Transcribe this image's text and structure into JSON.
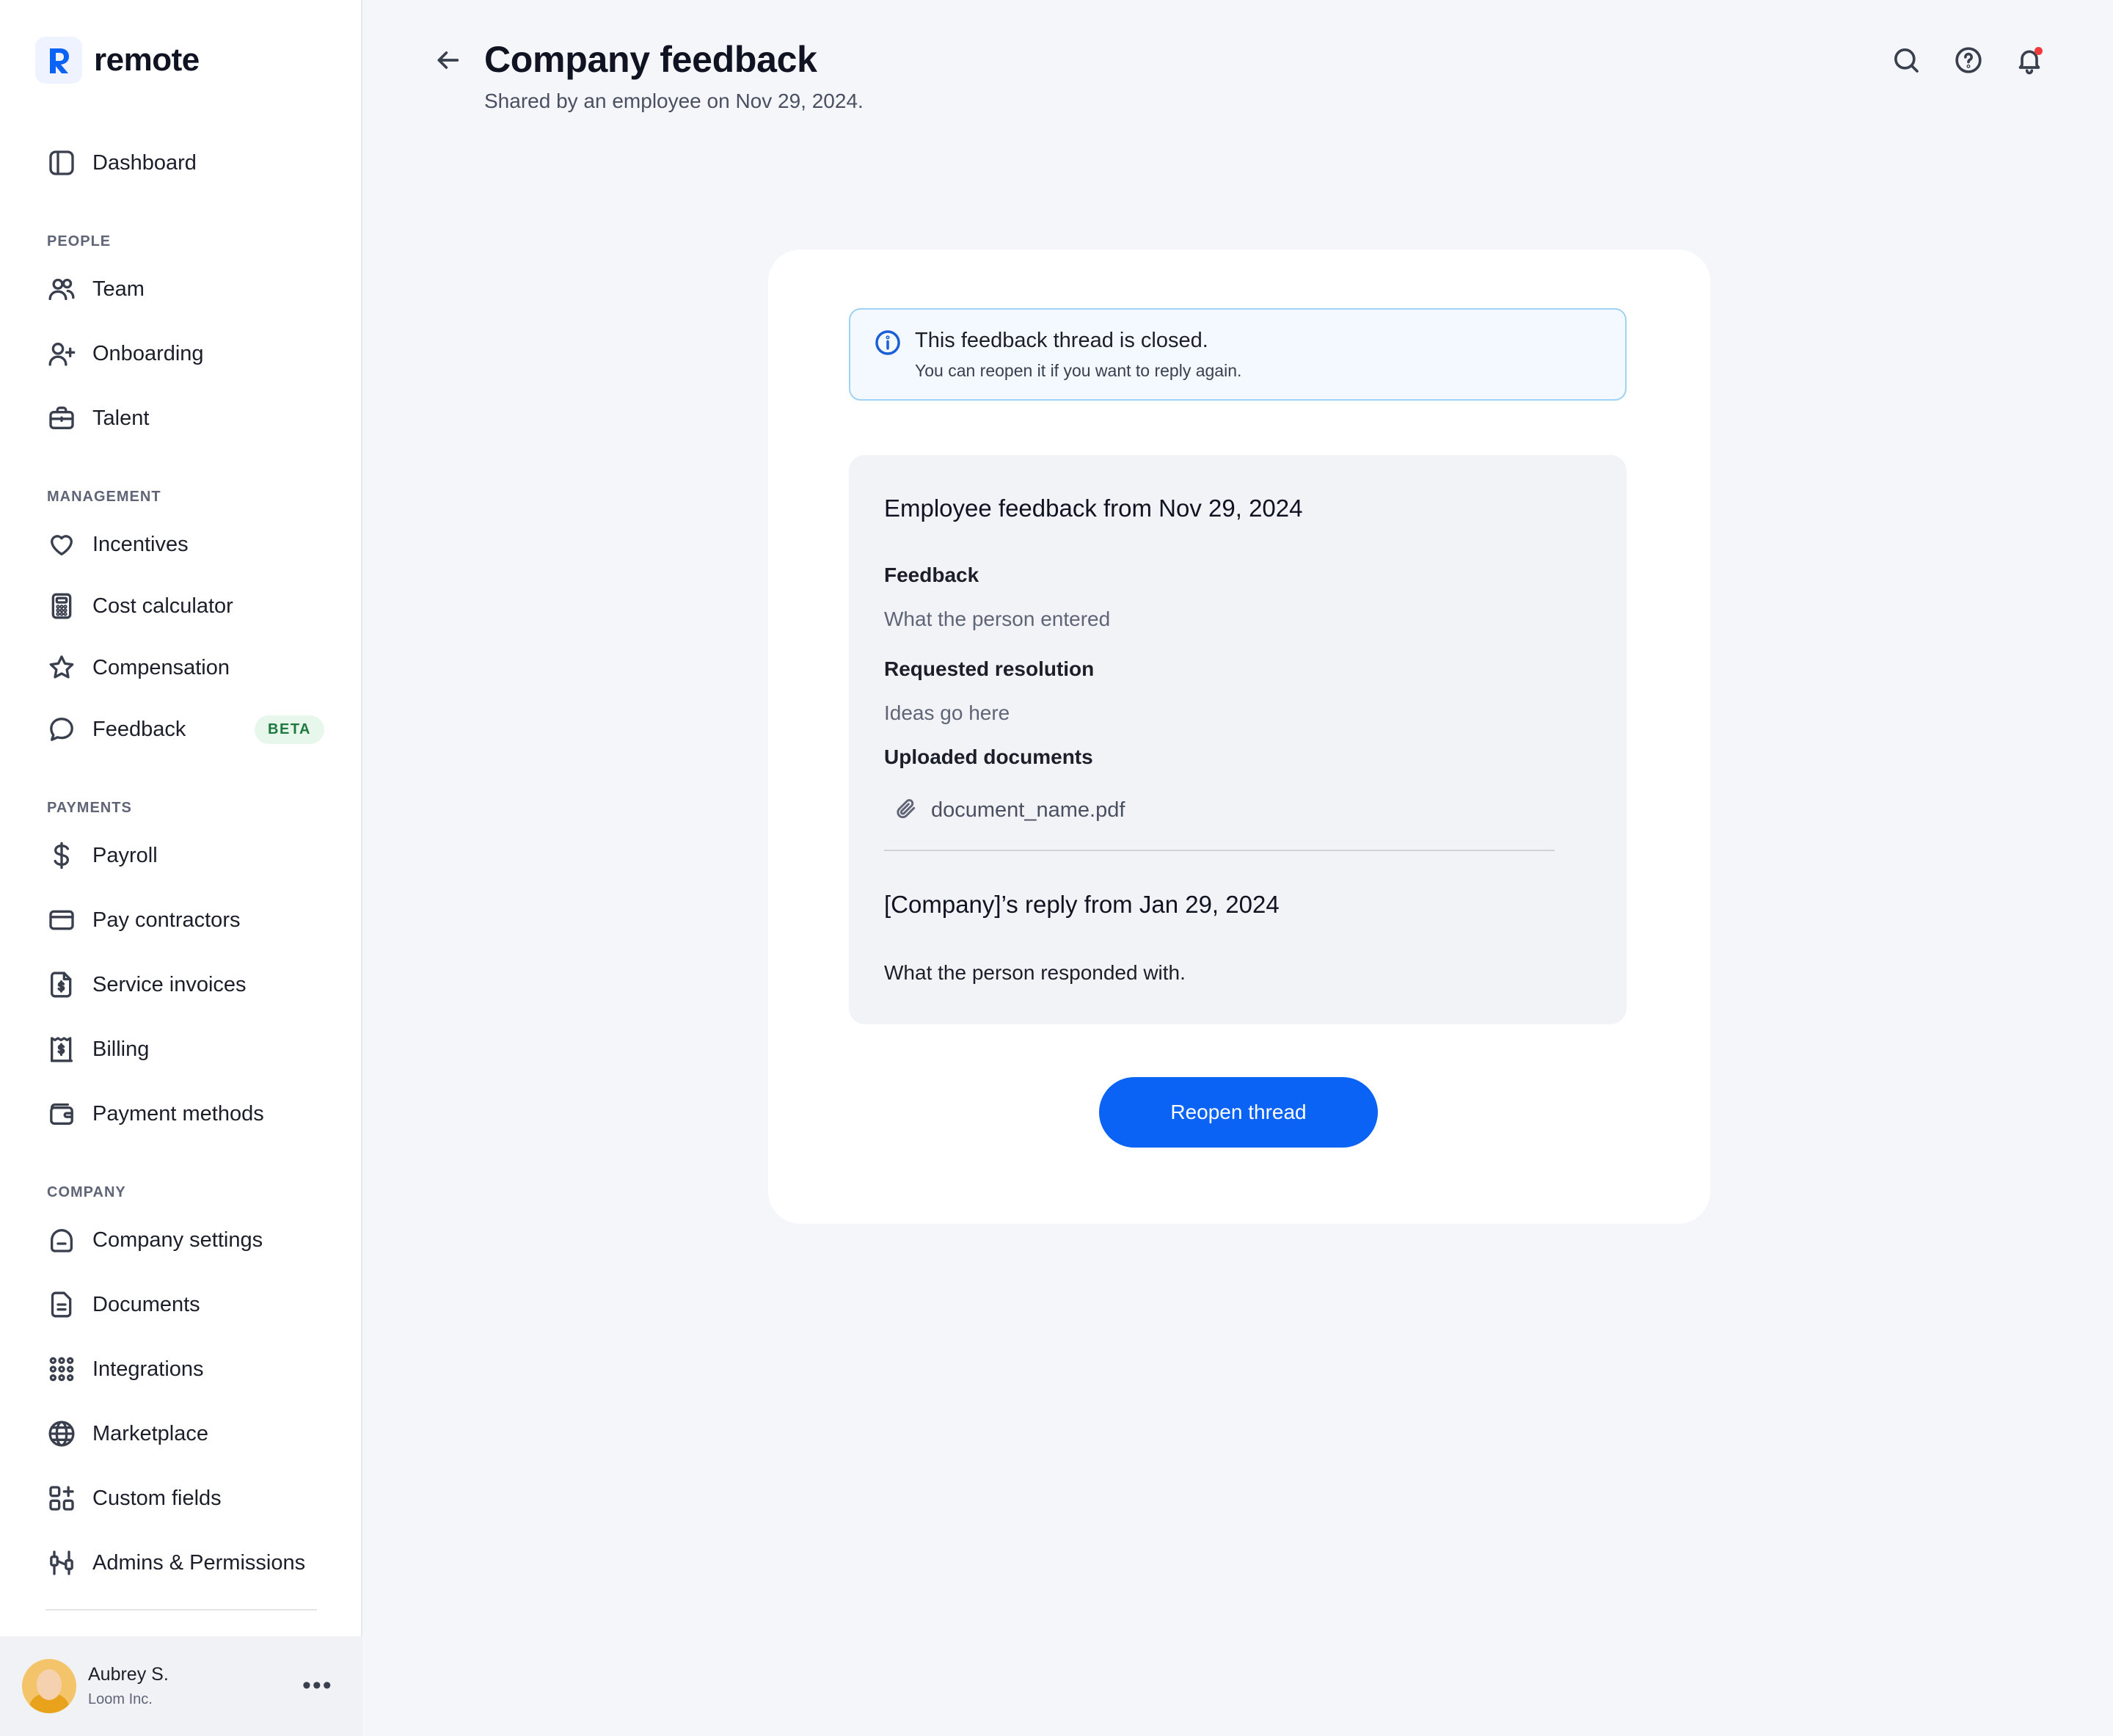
{
  "app": {
    "brand": "remote",
    "brand_color": "#0b63f6"
  },
  "sidebar": {
    "dashboard": {
      "label": "Dashboard",
      "icon": "sidebar-layout-icon"
    },
    "sections": [
      {
        "label": "PEOPLE",
        "items": [
          {
            "label": "Team",
            "icon": "users-icon"
          },
          {
            "label": "Onboarding",
            "icon": "user-plus-icon"
          },
          {
            "label": "Talent",
            "icon": "briefcase-icon"
          }
        ]
      },
      {
        "label": "MANAGEMENT",
        "items": [
          {
            "label": "Incentives",
            "icon": "heart-icon"
          },
          {
            "label": "Cost calculator",
            "icon": "calculator-icon"
          },
          {
            "label": "Compensation",
            "icon": "star-icon"
          },
          {
            "label": "Feedback",
            "icon": "chat-bubble-icon",
            "badge": "BETA"
          }
        ]
      },
      {
        "label": "PAYMENTS",
        "items": [
          {
            "label": "Payroll",
            "icon": "dollar-icon"
          },
          {
            "label": "Pay contractors",
            "icon": "credit-card-icon"
          },
          {
            "label": "Service invoices",
            "icon": "invoice-icon"
          },
          {
            "label": "Billing",
            "icon": "receipt-icon"
          },
          {
            "label": "Payment methods",
            "icon": "wallet-icon"
          }
        ]
      },
      {
        "label": "COMPANY",
        "items": [
          {
            "label": "Company settings",
            "icon": "company-icon"
          },
          {
            "label": "Documents",
            "icon": "document-icon"
          },
          {
            "label": "Integrations",
            "icon": "grid-dots-icon"
          },
          {
            "label": "Marketplace",
            "icon": "globe-icon"
          },
          {
            "label": "Custom fields",
            "icon": "custom-fields-icon"
          },
          {
            "label": "Admins & Permissions",
            "icon": "sliders-icon"
          }
        ]
      }
    ],
    "user": {
      "name": "Aubrey S.",
      "company": "Loom Inc.",
      "more": "•••"
    }
  },
  "header": {
    "title": "Company feedback",
    "subtitle": "Shared by an employee on Nov 29, 2024.",
    "icons": [
      "search-icon",
      "help-icon",
      "bell-icon"
    ]
  },
  "alert": {
    "title": "This feedback thread is closed.",
    "text": "You can reopen it if you want to reply again."
  },
  "feedback": {
    "title": "Employee feedback from Nov 29, 2024",
    "feedback_label": "Feedback",
    "feedback_value": "What the person entered",
    "resolution_label": "Requested resolution",
    "resolution_value": "Ideas go here",
    "documents_label": "Uploaded documents",
    "document_name": "document_name.pdf",
    "reply_title": "[Company]’s reply from Jan 29, 2024",
    "reply_text": "What the person responded with."
  },
  "actions": {
    "reopen_label": "Reopen thread"
  }
}
